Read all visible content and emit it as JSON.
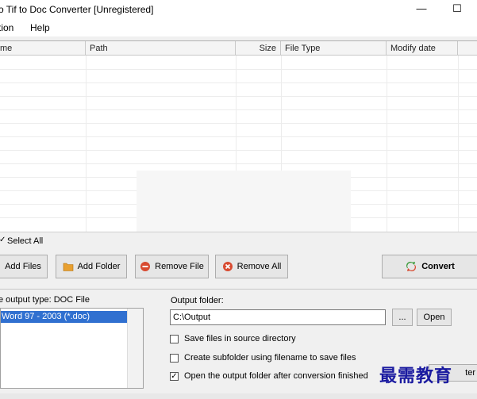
{
  "window": {
    "title": "o Tif to Doc Converter [Unregistered]",
    "minimize_glyph": "—",
    "maximize_glyph": "☐"
  },
  "menu": {
    "items": [
      "tion",
      "Help"
    ]
  },
  "file_list": {
    "columns": [
      "me",
      "Path",
      "Size",
      "File Type",
      "Modify date"
    ],
    "rows": []
  },
  "select_all": {
    "label": "Select All",
    "checked_glyph": "✓"
  },
  "toolbar": {
    "add_files": "Add Files",
    "add_folder": "Add Folder",
    "remove_file": "Remove File",
    "remove_all": "Remove All",
    "convert": "Convert"
  },
  "output_type": {
    "label": "e output type:  DOC File",
    "options": [
      "Word 97 - 2003 (*.doc)"
    ],
    "selected": "Word 97 - 2003 (*.doc)"
  },
  "output_folder": {
    "label": "Output folder:",
    "value": "C:\\Output",
    "browse_label": "...",
    "open_label": "Open"
  },
  "options": [
    {
      "label": "Save files in source directory",
      "checked": false
    },
    {
      "label": "Create subfolder using filename to save files",
      "checked": false
    },
    {
      "label": "Open the output folder after conversion finished",
      "checked": true
    }
  ],
  "partial_button": {
    "label": "ter"
  },
  "watermark": {
    "text": "最需教育"
  },
  "colors": {
    "selection": "#3070d0",
    "folder_icon": "#e8a030",
    "remove_icon": "#d84a30",
    "convert_green": "#3a9a3a",
    "convert_red": "#d84a30",
    "watermark": "#1a1aa0"
  }
}
